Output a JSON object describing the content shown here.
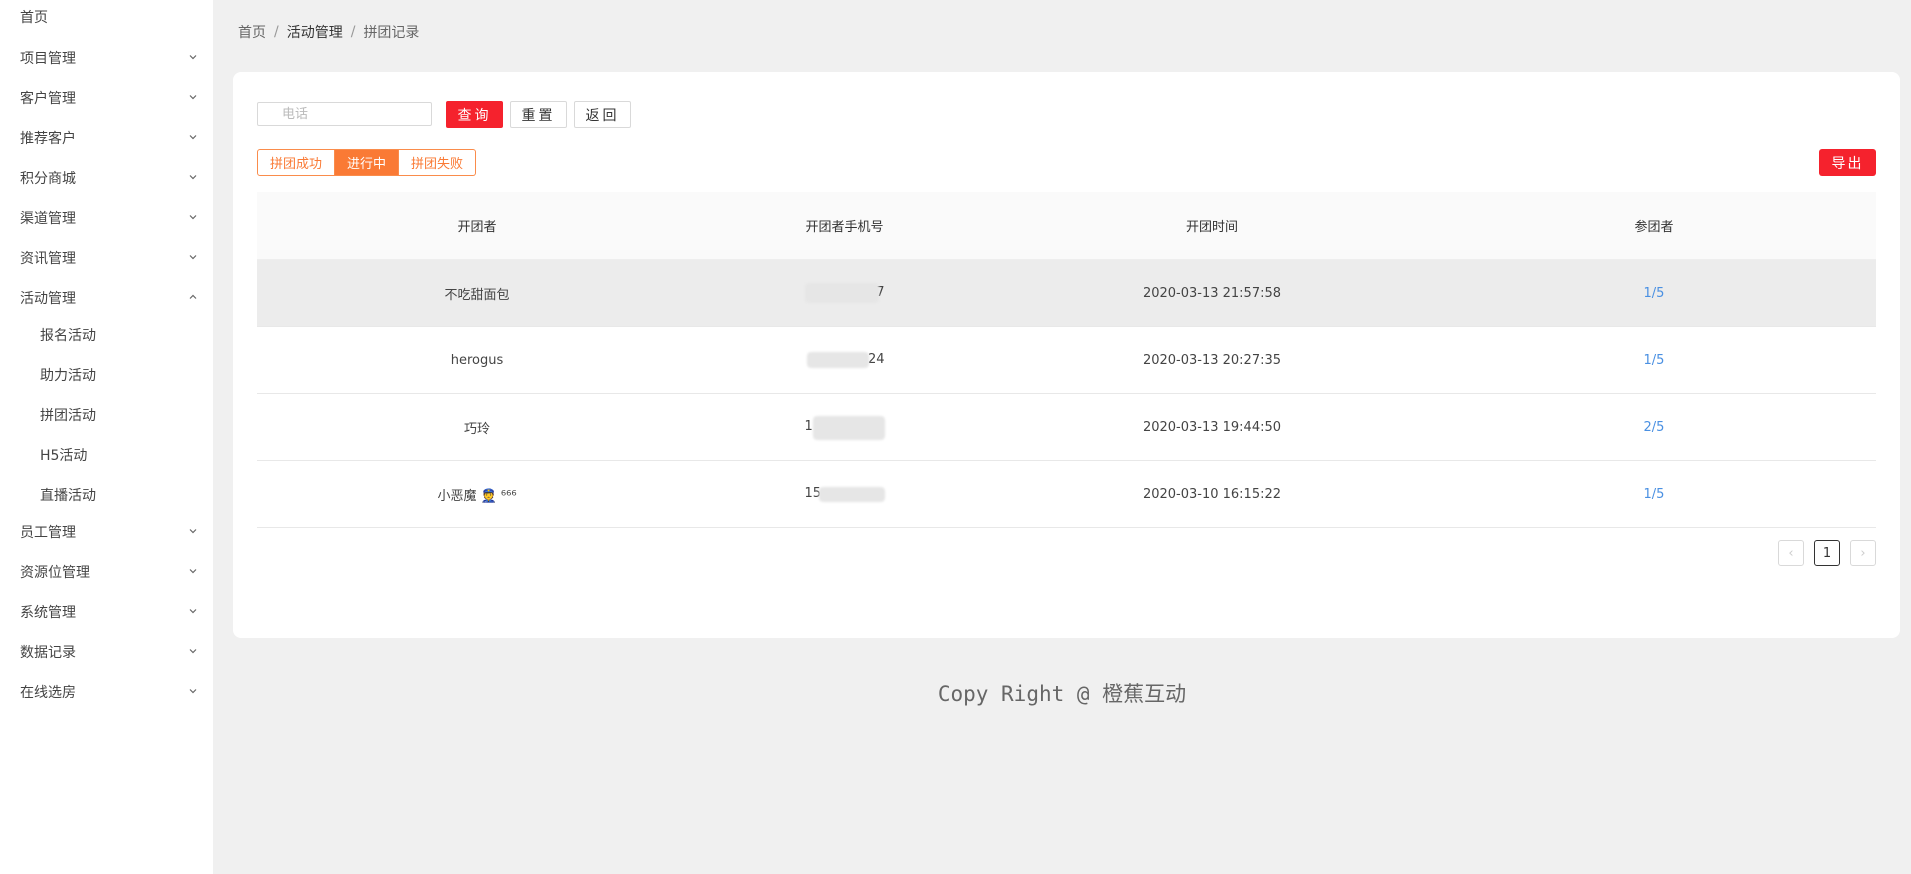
{
  "sidebar": {
    "items": [
      {
        "label": "首页"
      },
      {
        "label": "项目管理"
      },
      {
        "label": "客户管理"
      },
      {
        "label": "推荐客户"
      },
      {
        "label": "积分商城"
      },
      {
        "label": "渠道管理"
      },
      {
        "label": "资讯管理"
      },
      {
        "label": "活动管理"
      },
      {
        "label": "员工管理"
      },
      {
        "label": "资源位管理"
      },
      {
        "label": "系统管理"
      },
      {
        "label": "数据记录"
      },
      {
        "label": "在线选房"
      }
    ],
    "subitems": [
      {
        "label": "报名活动"
      },
      {
        "label": "助力活动"
      },
      {
        "label": "拼团活动"
      },
      {
        "label": "H5活动"
      },
      {
        "label": "直播活动"
      }
    ]
  },
  "breadcrumb": {
    "home": "首页",
    "section": "活动管理",
    "current": "拼团记录",
    "sep": "/"
  },
  "search": {
    "placeholder": "电话"
  },
  "buttons": {
    "query": "查询",
    "reset": "重置",
    "back": "返回",
    "export": "导出"
  },
  "tabs": [
    {
      "label": "拼团成功"
    },
    {
      "label": "进行中"
    },
    {
      "label": "拼团失败"
    }
  ],
  "table": {
    "headers": [
      "开团者",
      "开团者手机号",
      "开团时间",
      "参团者"
    ],
    "rows": [
      {
        "name": "不吃甜面包",
        "phone_visible": "7",
        "time": "2020-03-13 21:57:58",
        "members": "1/5"
      },
      {
        "name": "herogus",
        "phone_visible": "24",
        "time": "2020-03-13 20:27:35",
        "members": "1/5"
      },
      {
        "name": "巧玲",
        "phone_visible": "1",
        "time": "2020-03-13 19:44:50",
        "members": "2/5"
      },
      {
        "name": "小恶魔 👮 ⁶⁶⁶",
        "phone_visible": "15",
        "time": "2020-03-10 16:15:22",
        "members": "1/5"
      }
    ]
  },
  "pagination": {
    "prev": "‹",
    "current": "1",
    "next": "›"
  },
  "footer": "Copy Right @ 橙蕉互动",
  "colors": {
    "primary_red": "#f5222d",
    "tab_orange": "#fa7a35",
    "link_blue": "#4a90e2"
  }
}
